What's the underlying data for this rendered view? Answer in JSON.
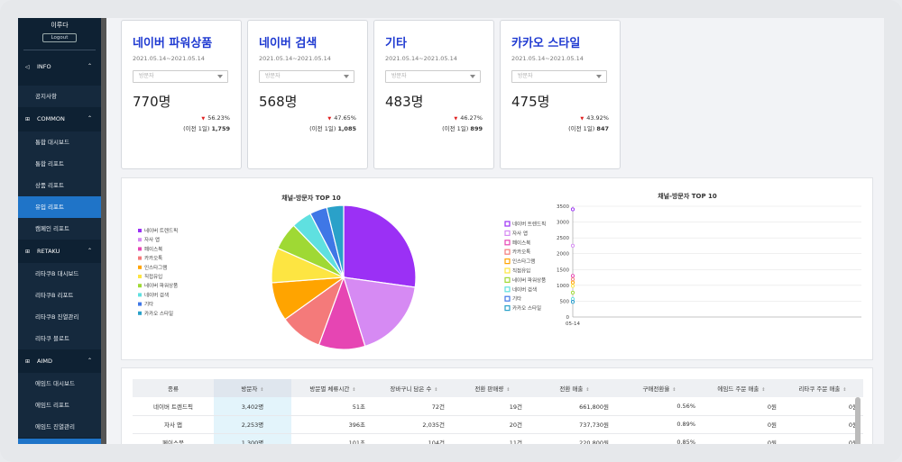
{
  "sidebar": {
    "user_name": "이루다",
    "logout_label": "Logout",
    "sections": [
      {
        "label": "INFO",
        "icon": "megaphone-icon",
        "items": [
          "공지사항"
        ]
      },
      {
        "label": "COMMON",
        "icon": "grid-icon",
        "items": [
          "통합 대시보드",
          "통합 리포트",
          "상품 리포트",
          "유입 리포트",
          "캠페인 리포트"
        ]
      },
      {
        "label": "RETAKU",
        "icon": "grid-icon",
        "items": [
          "리타쿠B 대시보드",
          "리타쿠B 리포트",
          "리타쿠B 진열관리",
          "리타쿠 블로트"
        ]
      },
      {
        "label": "AIMD",
        "icon": "grid-icon",
        "items": [
          "에임드 대시보드",
          "에임드 리포트",
          "에임드 진열관리"
        ]
      }
    ],
    "active_item": "유입 리포트"
  },
  "cards": [
    {
      "title": "네이버 파워상품",
      "date": "2021.05.14~2021.05.14",
      "select": "방문자",
      "value": "770명",
      "pct": "56.23%",
      "prev_label": "(이전 1일)",
      "prev_value": "1,759"
    },
    {
      "title": "네이버 검색",
      "date": "2021.05.14~2021.05.14",
      "select": "방문자",
      "value": "568명",
      "pct": "47.65%",
      "prev_label": "(이전 1일)",
      "prev_value": "1,085"
    },
    {
      "title": "기타",
      "date": "2021.05.14~2021.05.14",
      "select": "방문자",
      "value": "483명",
      "pct": "46.27%",
      "prev_label": "(이전 1일)",
      "prev_value": "899"
    },
    {
      "title": "카카오 스타일",
      "date": "2021.05.14~2021.05.14",
      "select": "방문자",
      "value": "475명",
      "pct": "43.92%",
      "prev_label": "(이전 1일)",
      "prev_value": "847"
    }
  ],
  "colors": {
    "sidebar_bg": "#0e2133",
    "active": "#1f74c8",
    "card_title": "#1f3ad1",
    "down_arrow": "#e02020"
  },
  "chart_data": [
    {
      "type": "pie",
      "title": "채널-방문자 TOP 10",
      "legend_position": "left",
      "categories": [
        "네이버 트렌드픽",
        "자사 앱",
        "페이스북",
        "카카오톡",
        "인스타그램",
        "직접유입",
        "네이버 파워상품",
        "네이버 검색",
        "기타",
        "카카오 스타일"
      ],
      "values": [
        3402,
        2253,
        1300,
        1190,
        1090,
        980,
        770,
        568,
        483,
        475
      ],
      "colors": [
        "#9b30f5",
        "#d68af3",
        "#e645b3",
        "#f47a7a",
        "#ffa400",
        "#fde542",
        "#9fd934",
        "#5fe0e0",
        "#3f77e6",
        "#2aa1c9"
      ]
    },
    {
      "type": "line",
      "title": "채널-방문자 TOP 10",
      "legend_position": "left",
      "x": [
        "05-14"
      ],
      "yticks": [
        0,
        500,
        1000,
        1500,
        2000,
        2500,
        3000,
        3500
      ],
      "ylim": [
        0,
        3500
      ],
      "grid": true,
      "series": [
        {
          "name": "네이버 트렌드픽",
          "values": [
            3402
          ]
        },
        {
          "name": "자사 앱",
          "values": [
            2253
          ]
        },
        {
          "name": "페이스북",
          "values": [
            1300
          ]
        },
        {
          "name": "카카오톡",
          "values": [
            1190
          ]
        },
        {
          "name": "인스타그램",
          "values": [
            1090
          ]
        },
        {
          "name": "직접유입",
          "values": [
            980
          ]
        },
        {
          "name": "네이버 파워상품",
          "values": [
            770
          ]
        },
        {
          "name": "네이버 검색",
          "values": [
            568
          ]
        },
        {
          "name": "기타",
          "values": [
            483
          ]
        },
        {
          "name": "카카오 스타일",
          "values": [
            475
          ]
        }
      ],
      "colors": [
        "#9b30f5",
        "#d68af3",
        "#e645b3",
        "#f47a7a",
        "#ffa400",
        "#fde542",
        "#9fd934",
        "#5fe0e0",
        "#3f77e6",
        "#2aa1c9"
      ]
    }
  ],
  "table": {
    "headers": [
      "종류",
      "방문자",
      "방문별 체류시간",
      "장바구니 담은 수",
      "전환 판매량",
      "전환 매출",
      "구매전환율",
      "에임드 주문 매출",
      "리타쿠 주문 매출"
    ],
    "rows": [
      [
        "네이버 트렌드픽",
        "3,402명",
        "51초",
        "72건",
        "19건",
        "661,800원",
        "0.56%",
        "0원",
        "0원"
      ],
      [
        "자사 앱",
        "2,253명",
        "396초",
        "2,035건",
        "20건",
        "737,730원",
        "0.89%",
        "0원",
        "0원"
      ],
      [
        "페이스북",
        "1,300명",
        "101초",
        "104건",
        "11건",
        "220,800원",
        "0.85%",
        "0원",
        "0원"
      ]
    ]
  }
}
